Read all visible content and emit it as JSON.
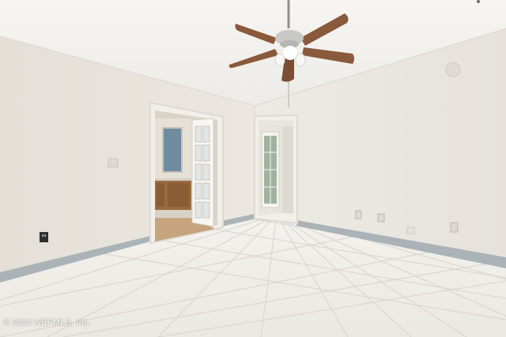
{
  "photo": {
    "watermark": "© 2024 NEFMLS, Inc.",
    "colors": {
      "ceiling": "#f4f3f0",
      "wall_left": "#e7e3dc",
      "wall_right": "#ebe8e2",
      "floor_tile": "#f1efea",
      "grout": "#d9d5cc",
      "baseboard": "#a9b2b6",
      "fan_blade": "#8a5a3c",
      "cabinet": "#9b6b3f"
    }
  }
}
